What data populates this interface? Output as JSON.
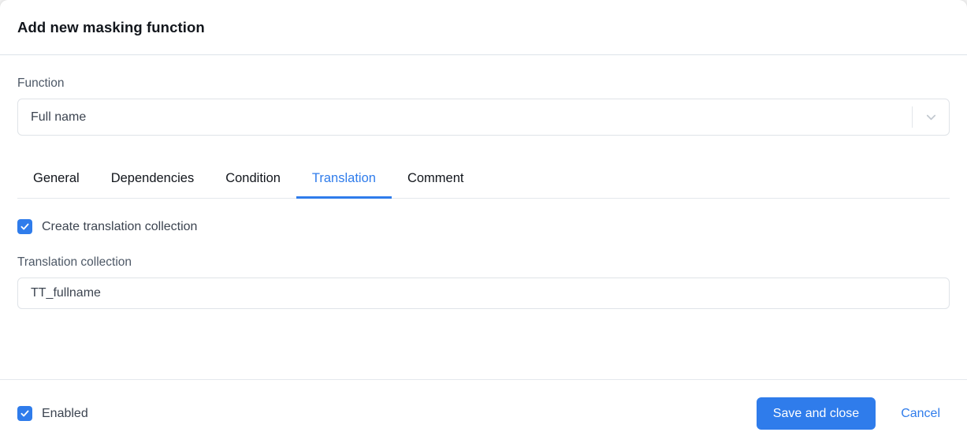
{
  "dialog": {
    "title": "Add new masking function"
  },
  "function_field": {
    "label": "Function",
    "value": "Full name",
    "dropdown_icon": "chevron-down-icon"
  },
  "tabs": [
    {
      "label": "General",
      "active": false
    },
    {
      "label": "Dependencies",
      "active": false
    },
    {
      "label": "Condition",
      "active": false
    },
    {
      "label": "Translation",
      "active": true
    },
    {
      "label": "Comment",
      "active": false
    }
  ],
  "translation_panel": {
    "create_collection": {
      "label": "Create translation collection",
      "checked": true
    },
    "collection_field": {
      "label": "Translation collection",
      "value": "TT_fullname"
    }
  },
  "footer": {
    "enabled": {
      "label": "Enabled",
      "checked": true
    },
    "save_label": "Save and close",
    "cancel_label": "Cancel"
  },
  "colors": {
    "accent": "#2f7ceb",
    "border": "#dfe3e8",
    "divider": "#e4e8ed",
    "label_text": "#4d5866",
    "title_text": "#12161c"
  }
}
